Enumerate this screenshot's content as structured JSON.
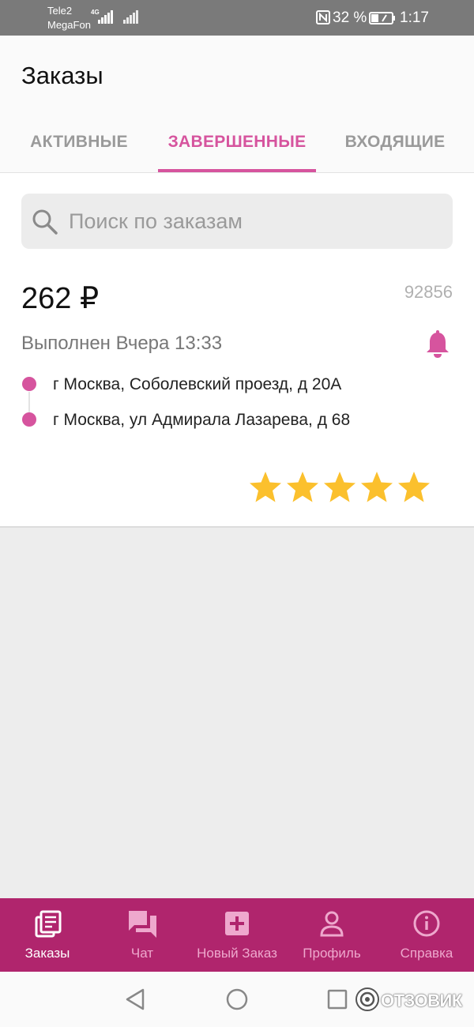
{
  "status_bar": {
    "carrier1": "Tele2",
    "carrier2": "MegaFon",
    "network": "4G",
    "battery_percent": "32 %",
    "time": "1:17"
  },
  "header": {
    "title": "Заказы",
    "tabs": [
      {
        "label": "АКТИВНЫЕ",
        "active": false
      },
      {
        "label": "ЗАВЕРШЕННЫЕ",
        "active": true
      },
      {
        "label": "ВХОДЯЩИЕ",
        "active": false
      }
    ]
  },
  "search": {
    "placeholder": "Поиск по заказам",
    "value": ""
  },
  "order": {
    "price": "262 ₽",
    "id": "92856",
    "status": "Выполнен Вчера 13:33",
    "from": "г Москва, Соболевский проезд, д 20А",
    "to": "г Москва, ул Адмирала Лазарева, д 68",
    "rating": 5,
    "rating_max": 5
  },
  "bottom_nav": {
    "items": [
      {
        "label": "Заказы",
        "icon": "orders-icon",
        "active": true
      },
      {
        "label": "Чат",
        "icon": "chat-icon",
        "active": false
      },
      {
        "label": "Новый Заказ",
        "icon": "plus-square-icon",
        "active": false
      },
      {
        "label": "Профиль",
        "icon": "person-icon",
        "active": false
      },
      {
        "label": "Справка",
        "icon": "info-icon",
        "active": false
      }
    ]
  },
  "watermark": {
    "text": "ОТЗОВИК"
  },
  "colors": {
    "accent": "#d6549e",
    "nav_bg": "#b0256d",
    "star": "#fbc02d",
    "status_bar": "#7a7a7a"
  }
}
